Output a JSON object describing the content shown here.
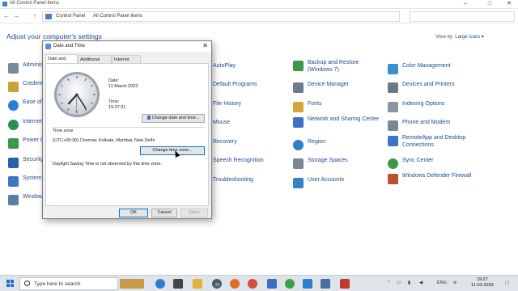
{
  "window": {
    "title": "All Control Panel Items",
    "controls": {
      "minimize": "–",
      "maximize": "□",
      "close": "✕"
    }
  },
  "address": {
    "back": "←",
    "forward": "→",
    "up": "↑",
    "crumbs": [
      "Control Panel",
      "All Control Panel Items"
    ]
  },
  "heading": "Adjust your computer's settings",
  "view_by": {
    "label": "View by:",
    "value": "Large icons ▾"
  },
  "items": [
    {
      "label": "Administrative Tools",
      "icon": "admin-tools-icon",
      "color": "#7b8a9a"
    },
    {
      "label": "Credential Manager",
      "icon": "credential-icon",
      "color": "#c9a23a"
    },
    {
      "label": "Ease of Access Center",
      "icon": "ease-access-icon",
      "color": "#2a7fd4"
    },
    {
      "label": "Internet Options",
      "icon": "internet-icon",
      "color": "#2c8c5a"
    },
    {
      "label": "Power Options",
      "icon": "power-icon",
      "color": "#3a9a4a"
    },
    {
      "label": "Security and Maintenance",
      "icon": "security-icon",
      "color": "#2a5fb0"
    },
    {
      "label": "System",
      "icon": "system-icon",
      "color": "#3d78c5"
    },
    {
      "label": "Windows Tools",
      "icon": "windows-tools-icon",
      "color": "#5a7fa8"
    },
    {
      "label": "AutoPlay",
      "icon": "autoplay-icon",
      "color": "#2f9a4f"
    },
    {
      "label": "Default Programs",
      "icon": "default-programs-icon",
      "color": "#3e7ac8"
    },
    {
      "label": "File History",
      "icon": "file-history-icon",
      "color": "#d9a43a"
    },
    {
      "label": "Mouse",
      "icon": "mouse-icon",
      "color": "#888888"
    },
    {
      "label": "Recovery",
      "icon": "recovery-icon",
      "color": "#2f7fc2"
    },
    {
      "label": "Speech Recognition",
      "icon": "microphone-icon",
      "color": "#7f8a96"
    },
    {
      "label": "Troubleshooting",
      "icon": "troubleshooting-icon",
      "color": "#4d85c9"
    },
    {
      "label": "Backup and Restore (Windows 7)",
      "icon": "backup-icon",
      "color": "#3a9a4a"
    },
    {
      "label": "Device Manager",
      "icon": "device-manager-icon",
      "color": "#6d7c8b"
    },
    {
      "label": "Fonts",
      "icon": "fonts-icon",
      "color": "#d9a43a"
    },
    {
      "label": "Network and Sharing Center",
      "icon": "network-icon",
      "color": "#3a74c2"
    },
    {
      "label": "Region",
      "icon": "region-icon",
      "color": "#2f7fc2"
    },
    {
      "label": "Storage Spaces",
      "icon": "storage-icon",
      "color": "#7a8796"
    },
    {
      "label": "User Accounts",
      "icon": "user-accounts-icon",
      "color": "#3a7fc9"
    },
    {
      "label": "Color Management",
      "icon": "color-management-icon",
      "color": "#3a8fd0"
    },
    {
      "label": "Devices and Printers",
      "icon": "printer-icon",
      "color": "#6b7886"
    },
    {
      "label": "Indexing Options",
      "icon": "indexing-icon",
      "color": "#8a96a3"
    },
    {
      "label": "Phone and Modem",
      "icon": "phone-icon",
      "color": "#7a8796"
    },
    {
      "label": "RemoteApp and Desktop Connections",
      "icon": "remoteapp-icon",
      "color": "#3a74c2"
    },
    {
      "label": "Sync Center",
      "icon": "sync-icon",
      "color": "#3a9a4a"
    },
    {
      "label": "Windows Defender Firewall",
      "icon": "firewall-icon",
      "color": "#b5542f"
    }
  ],
  "dialog": {
    "title": "Date and Time",
    "close": "✕",
    "tabs": [
      "Date and Time",
      "Additional Clocks",
      "Internet Time"
    ],
    "date_label": "Date:",
    "date_value": "11 March 2023",
    "time_label": "Time:",
    "time_value": "19:27:31",
    "change_datetime_button": "Change date and time...",
    "timezone_label": "Time zone",
    "timezone_value": "(UTC+05:30) Chennai, Kolkata, Mumbai, New Delhi",
    "change_timezone_button": "Change time zone...",
    "dst_note": "Daylight Saving Time is not observed by this time zone.",
    "ok": "OK",
    "cancel": "Cancel",
    "apply": "Apply"
  },
  "taskbar": {
    "search_placeholder": "Type here to search",
    "tray_language": "ENG",
    "clock_time": "19:27",
    "clock_date": "11-03-2023",
    "notification_count": "21"
  }
}
